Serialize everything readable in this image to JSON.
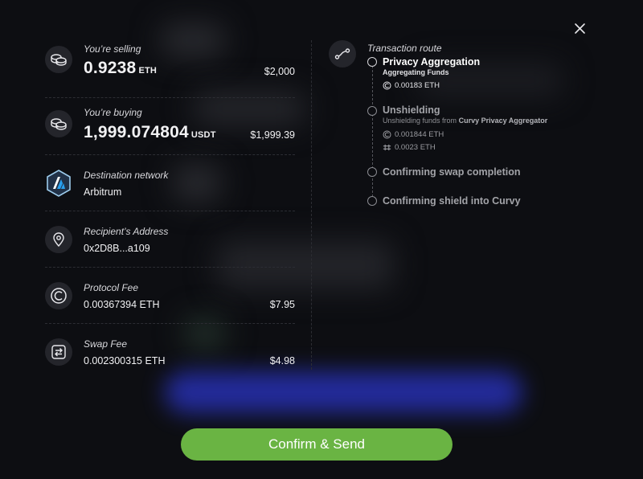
{
  "selling": {
    "label": "You’re selling",
    "amount": "0.9238",
    "unit": "ETH",
    "usd": "$2,000",
    "icon": "coins-icon"
  },
  "buying": {
    "label": "You’re buying",
    "amount": "1,999.074804",
    "unit": "USDT",
    "usd": "$1,999.39",
    "icon": "coins-icon"
  },
  "destination": {
    "label": "Destination network",
    "value": "Arbitrum",
    "icon": "arbitrum-logo-icon"
  },
  "recipient": {
    "label": "Recipient’s Address",
    "value": "0x2D8B...a109",
    "icon": "location-pin-icon"
  },
  "protocol_fee": {
    "label": "Protocol Fee",
    "value": "0.00367394 ETH",
    "usd": "$7.95",
    "icon": "curvy-logo-icon"
  },
  "swap_fee": {
    "label": "Swap Fee",
    "value": "0.002300315 ETH",
    "usd": "$4.98",
    "icon": "swap-arrows-icon"
  },
  "route": {
    "title": "Transaction route",
    "icon": "route-icon",
    "steps": [
      {
        "name": "Privacy Aggregation",
        "sub": "Aggregating Funds",
        "amounts": [
          "0.00183 ETH"
        ]
      },
      {
        "name": "Unshielding",
        "sub": "Unshielding funds from",
        "sub_highlight": "Curvy Privacy Aggregator",
        "amounts": [
          "0.001844 ETH",
          "0.0023 ETH"
        ]
      },
      {
        "name": "Confirming swap completion"
      },
      {
        "name": "Confirming shield into Curvy"
      }
    ]
  },
  "confirm_label": "Confirm & Send",
  "colors": {
    "accent": "#6ab443",
    "background": "#0d0e12",
    "blur_button": "#2b35c9"
  }
}
